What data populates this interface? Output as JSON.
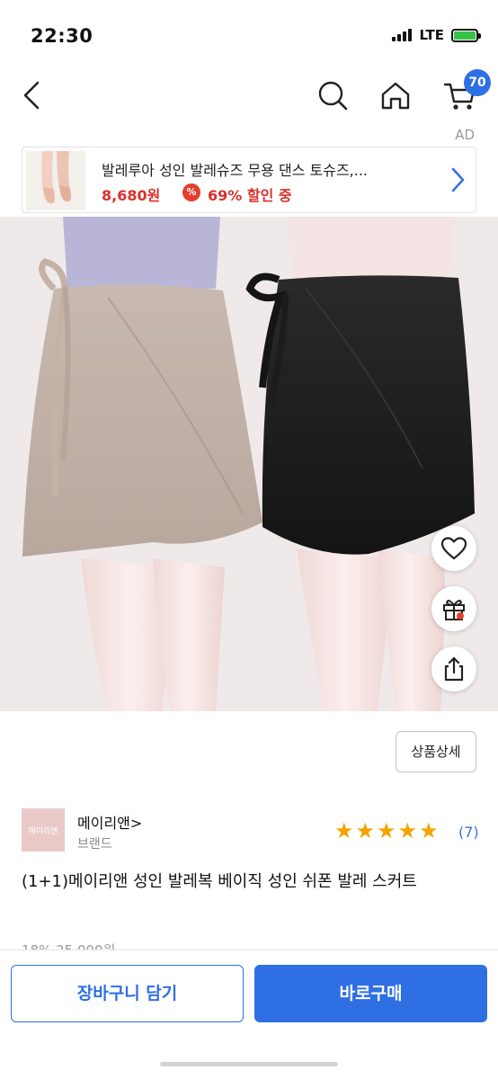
{
  "status": {
    "time": "22:30",
    "network": "LTE"
  },
  "nav": {
    "cart_count": "70"
  },
  "ad": {
    "label": "AD",
    "title": "발레루아 성인 발레슈즈 무용 댄스 토슈즈,...",
    "price": "8,680원",
    "badge_glyph": "%",
    "discount": "69% 할인 중"
  },
  "actions": {
    "detail_label": "상품상세"
  },
  "brand": {
    "name": "메이리앤",
    "chevron": ">",
    "subtitle": "브랜드",
    "logo_text": "메이리앤"
  },
  "rating": {
    "stars": 5,
    "count": "(7)"
  },
  "product": {
    "title": "(1+1)메이리앤 성인 발레복 베이직 성인 쉬폰 발레 스커트",
    "price_peek": "18% 25,000원"
  },
  "bottom": {
    "cart_label": "장바구니 담기",
    "buy_label": "바로구매"
  },
  "colors": {
    "accent": "#2f6fe4",
    "sale_red": "#d9312b",
    "star": "#f2a500"
  }
}
